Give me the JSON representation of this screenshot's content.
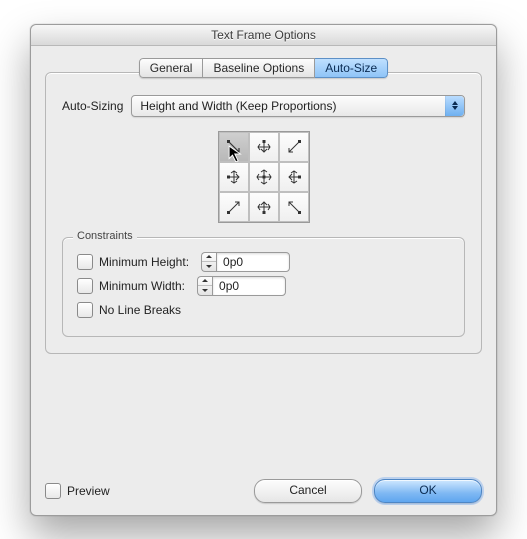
{
  "window": {
    "title": "Text Frame Options"
  },
  "tabs": {
    "general": "General",
    "baseline": "Baseline Options",
    "autosize": "Auto-Size"
  },
  "autosize": {
    "label": "Auto-Sizing",
    "select_value": "Height and Width (Keep Proportions)"
  },
  "constraints": {
    "title": "Constraints",
    "min_height_label": "Minimum Height:",
    "min_height_value": "0p0",
    "min_width_label": "Minimum Width:",
    "min_width_value": "0p0",
    "no_line_breaks_label": "No Line Breaks"
  },
  "footer": {
    "preview_label": "Preview",
    "cancel": "Cancel",
    "ok": "OK"
  }
}
